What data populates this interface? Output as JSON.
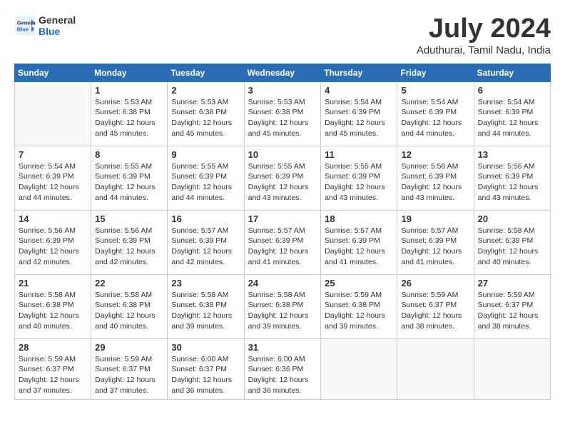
{
  "header": {
    "logo": {
      "general": "General",
      "blue": "Blue"
    },
    "title": "July 2024",
    "location": "Aduthurai, Tamil Nadu, India"
  },
  "calendar": {
    "days_of_week": [
      "Sunday",
      "Monday",
      "Tuesday",
      "Wednesday",
      "Thursday",
      "Friday",
      "Saturday"
    ],
    "weeks": [
      [
        {
          "day": "",
          "info": ""
        },
        {
          "day": "1",
          "info": "Sunrise: 5:53 AM\nSunset: 6:38 PM\nDaylight: 12 hours\nand 45 minutes."
        },
        {
          "day": "2",
          "info": "Sunrise: 5:53 AM\nSunset: 6:38 PM\nDaylight: 12 hours\nand 45 minutes."
        },
        {
          "day": "3",
          "info": "Sunrise: 5:53 AM\nSunset: 6:38 PM\nDaylight: 12 hours\nand 45 minutes."
        },
        {
          "day": "4",
          "info": "Sunrise: 5:54 AM\nSunset: 6:39 PM\nDaylight: 12 hours\nand 45 minutes."
        },
        {
          "day": "5",
          "info": "Sunrise: 5:54 AM\nSunset: 6:39 PM\nDaylight: 12 hours\nand 44 minutes."
        },
        {
          "day": "6",
          "info": "Sunrise: 5:54 AM\nSunset: 6:39 PM\nDaylight: 12 hours\nand 44 minutes."
        }
      ],
      [
        {
          "day": "7",
          "info": "Sunrise: 5:54 AM\nSunset: 6:39 PM\nDaylight: 12 hours\nand 44 minutes."
        },
        {
          "day": "8",
          "info": "Sunrise: 5:55 AM\nSunset: 6:39 PM\nDaylight: 12 hours\nand 44 minutes."
        },
        {
          "day": "9",
          "info": "Sunrise: 5:55 AM\nSunset: 6:39 PM\nDaylight: 12 hours\nand 44 minutes."
        },
        {
          "day": "10",
          "info": "Sunrise: 5:55 AM\nSunset: 6:39 PM\nDaylight: 12 hours\nand 43 minutes."
        },
        {
          "day": "11",
          "info": "Sunrise: 5:55 AM\nSunset: 6:39 PM\nDaylight: 12 hours\nand 43 minutes."
        },
        {
          "day": "12",
          "info": "Sunrise: 5:56 AM\nSunset: 6:39 PM\nDaylight: 12 hours\nand 43 minutes."
        },
        {
          "day": "13",
          "info": "Sunrise: 5:56 AM\nSunset: 6:39 PM\nDaylight: 12 hours\nand 43 minutes."
        }
      ],
      [
        {
          "day": "14",
          "info": "Sunrise: 5:56 AM\nSunset: 6:39 PM\nDaylight: 12 hours\nand 42 minutes."
        },
        {
          "day": "15",
          "info": "Sunrise: 5:56 AM\nSunset: 6:39 PM\nDaylight: 12 hours\nand 42 minutes."
        },
        {
          "day": "16",
          "info": "Sunrise: 5:57 AM\nSunset: 6:39 PM\nDaylight: 12 hours\nand 42 minutes."
        },
        {
          "day": "17",
          "info": "Sunrise: 5:57 AM\nSunset: 6:39 PM\nDaylight: 12 hours\nand 41 minutes."
        },
        {
          "day": "18",
          "info": "Sunrise: 5:57 AM\nSunset: 6:39 PM\nDaylight: 12 hours\nand 41 minutes."
        },
        {
          "day": "19",
          "info": "Sunrise: 5:57 AM\nSunset: 6:39 PM\nDaylight: 12 hours\nand 41 minutes."
        },
        {
          "day": "20",
          "info": "Sunrise: 5:58 AM\nSunset: 6:38 PM\nDaylight: 12 hours\nand 40 minutes."
        }
      ],
      [
        {
          "day": "21",
          "info": "Sunrise: 5:58 AM\nSunset: 6:38 PM\nDaylight: 12 hours\nand 40 minutes."
        },
        {
          "day": "22",
          "info": "Sunrise: 5:58 AM\nSunset: 6:38 PM\nDaylight: 12 hours\nand 40 minutes."
        },
        {
          "day": "23",
          "info": "Sunrise: 5:58 AM\nSunset: 6:38 PM\nDaylight: 12 hours\nand 39 minutes."
        },
        {
          "day": "24",
          "info": "Sunrise: 5:58 AM\nSunset: 6:38 PM\nDaylight: 12 hours\nand 39 minutes."
        },
        {
          "day": "25",
          "info": "Sunrise: 5:59 AM\nSunset: 6:38 PM\nDaylight: 12 hours\nand 39 minutes."
        },
        {
          "day": "26",
          "info": "Sunrise: 5:59 AM\nSunset: 6:37 PM\nDaylight: 12 hours\nand 38 minutes."
        },
        {
          "day": "27",
          "info": "Sunrise: 5:59 AM\nSunset: 6:37 PM\nDaylight: 12 hours\nand 38 minutes."
        }
      ],
      [
        {
          "day": "28",
          "info": "Sunrise: 5:59 AM\nSunset: 6:37 PM\nDaylight: 12 hours\nand 37 minutes."
        },
        {
          "day": "29",
          "info": "Sunrise: 5:59 AM\nSunset: 6:37 PM\nDaylight: 12 hours\nand 37 minutes."
        },
        {
          "day": "30",
          "info": "Sunrise: 6:00 AM\nSunset: 6:37 PM\nDaylight: 12 hours\nand 36 minutes."
        },
        {
          "day": "31",
          "info": "Sunrise: 6:00 AM\nSunset: 6:36 PM\nDaylight: 12 hours\nand 36 minutes."
        },
        {
          "day": "",
          "info": ""
        },
        {
          "day": "",
          "info": ""
        },
        {
          "day": "",
          "info": ""
        }
      ]
    ]
  }
}
